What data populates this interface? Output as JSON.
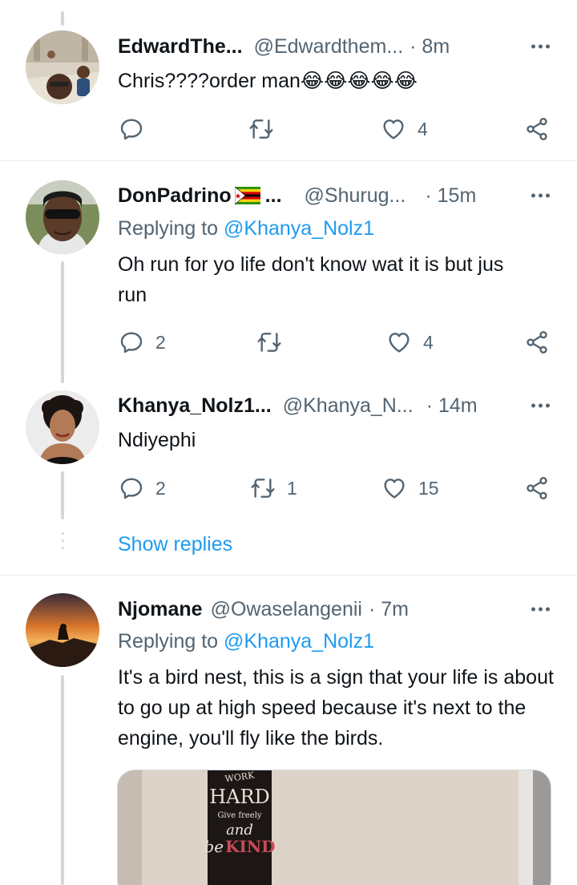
{
  "tweets": [
    {
      "name": "EdwardThe...",
      "handle": "@Edwardthem...",
      "time": "· 8m",
      "replying_prefix": "",
      "replying_to": "",
      "text": "Chris????order man",
      "emoji": "😂😂😂😂😂",
      "replies": "",
      "retweets": "",
      "likes": "4"
    },
    {
      "name": "DonPadrino",
      "name_suffix": "...",
      "handle": "@Shurug...",
      "time": "· 15m",
      "replying_prefix": "Replying to",
      "replying_to": "@Khanya_Nolz1",
      "text": "Oh run for yo life don't know wat it is but jus run",
      "replies": "2",
      "retweets": "",
      "likes": "4"
    },
    {
      "name": "Khanya_Nolz1...",
      "handle": "@Khanya_N...",
      "time": "· 14m",
      "text": "Ndiyephi",
      "replies": "2",
      "retweets": "1",
      "likes": "15"
    },
    {
      "name": "Njomane",
      "handle": "@Owaselangenii",
      "time": "· 7m",
      "replying_prefix": "Replying to",
      "replying_to": "@Khanya_Nolz1",
      "text": "It's a bird nest, this is a sign that your life is about to go up at high speed because it's next to the engine, you'll fly like the birds."
    }
  ],
  "show_replies_label": "Show replies",
  "media_sign_text": [
    "WORK",
    "HARD",
    "Give freely",
    "and",
    "be",
    "KIND"
  ],
  "colors": {
    "accent": "#1d9bf0",
    "secondary_text": "#536471",
    "thread_line": "#cfd9de"
  },
  "icons": {
    "reply": "reply-icon",
    "retweet": "retweet-icon",
    "like": "heart-icon",
    "share": "share-icon",
    "more": "more-icon"
  }
}
